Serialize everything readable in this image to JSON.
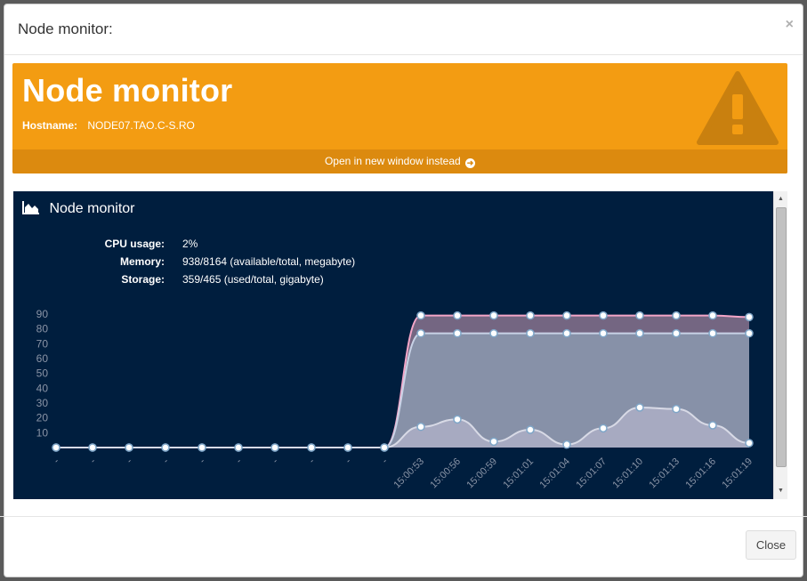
{
  "modal": {
    "title": "Node monitor:",
    "close_symbol": "×",
    "close_button": "Close"
  },
  "banner": {
    "title": "Node monitor",
    "hostname_label": "Hostname:",
    "hostname_value": "NODE07.TAO.C-S.RO",
    "footer_link": "Open in new window instead",
    "icon": "warning-triangle-icon",
    "color": "#f39c12"
  },
  "monitor": {
    "title": "Node monitor",
    "icon": "area-chart-icon",
    "background": "#001e3e",
    "stats": [
      {
        "label": "CPU usage:",
        "value": "2%"
      },
      {
        "label": "Memory:",
        "value": "938/8164 (available/total, megabyte)"
      },
      {
        "label": "Storage:",
        "value": "359/465 (used/total, gigabyte)"
      }
    ]
  },
  "chart_data": {
    "type": "area",
    "y_ticks": [
      10,
      20,
      30,
      40,
      50,
      60,
      70,
      80,
      90
    ],
    "ylim": [
      0,
      90
    ],
    "x": [
      "-",
      "-",
      "-",
      "-",
      "-",
      "-",
      "-",
      "-",
      "-",
      "-",
      "15:00:53",
      "15:00:56",
      "15:00:59",
      "15:01:01",
      "15:01:04",
      "15:01:07",
      "15:01:10",
      "15:01:13",
      "15:01:16",
      "15:01:19"
    ],
    "series": [
      {
        "color": "#f4a6c8",
        "fill": "#7a6a86",
        "values": [
          0,
          0,
          0,
          0,
          0,
          0,
          0,
          0,
          0,
          0,
          89,
          89,
          89,
          89,
          89,
          89,
          89,
          89,
          89,
          88
        ]
      },
      {
        "color": "#c8d2e6",
        "fill": "#8893aa",
        "values": [
          0,
          0,
          0,
          0,
          0,
          0,
          0,
          0,
          0,
          0,
          77,
          77,
          77,
          77,
          77,
          77,
          77,
          77,
          77,
          77
        ]
      },
      {
        "color": "#d8dae6",
        "fill": "#a9acc2",
        "values": [
          0,
          0,
          0,
          0,
          0,
          0,
          0,
          0,
          0,
          0,
          14,
          19,
          4,
          12,
          2,
          13,
          27,
          26,
          15,
          3
        ]
      }
    ]
  }
}
